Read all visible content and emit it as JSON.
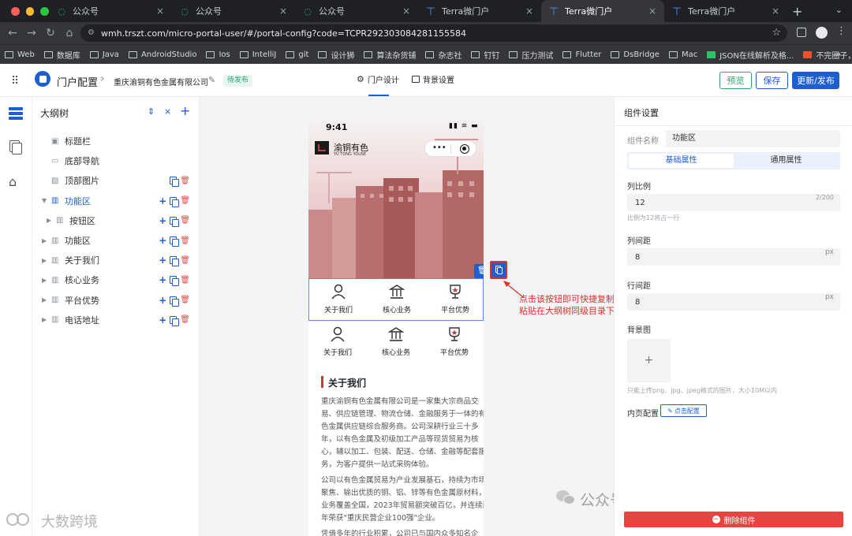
{
  "browser": {
    "tabs": [
      {
        "label": "公众号",
        "icon": "wechat-icon",
        "active": false
      },
      {
        "label": "公众号",
        "icon": "wechat-icon",
        "active": false
      },
      {
        "label": "公众号",
        "icon": "wechat-icon",
        "active": false
      },
      {
        "label": "Terra微门户",
        "icon": "terra-icon",
        "active": false
      },
      {
        "label": "Terra微门户",
        "icon": "terra-icon",
        "active": true
      },
      {
        "label": "Terra微门户",
        "icon": "terra-icon",
        "active": false
      }
    ],
    "url": "wmh.trszt.com/micro-portal-user/#/portal-config?code=TCPR292303084281155584",
    "bookmarks": [
      "Web",
      "数据库",
      "Java",
      "AndroidStudio",
      "Ios",
      "IntelliJ",
      "git",
      "设计狮",
      "算法杂货铺",
      "杂志社",
      "钉钉",
      "压力测试",
      "Flutter",
      "DsBridge",
      "Mac",
      "JSON在线解析及格...",
      "不完圈子，App可..."
    ],
    "colors": {
      "close": "#ff5f57",
      "minimize": "#febc2e",
      "maximize": "#28c840"
    }
  },
  "header": {
    "app_title": "门户配置",
    "separator": "›",
    "company": "重庆渝铜有色金属有限公司",
    "status_badge": "待发布",
    "tabs": [
      {
        "label": "门户设计",
        "icon": "gear-icon",
        "active": true
      },
      {
        "label": "背景设置",
        "icon": "image-icon",
        "active": false
      }
    ],
    "preview_label": "预览",
    "save_label": "保存",
    "publish_label": "更新/发布"
  },
  "outline": {
    "title": "大纲树",
    "rows": [
      {
        "label": "标题栏",
        "icon": "title-bar-icon",
        "caret": false,
        "level": 0,
        "actions": "none",
        "selected": false
      },
      {
        "label": "底部导航",
        "icon": "bottom-nav-icon",
        "caret": false,
        "level": 0,
        "actions": "none",
        "selected": false
      },
      {
        "label": "顶部图片",
        "icon": "image-icon",
        "caret": false,
        "level": 0,
        "actions": "copy-del",
        "selected": false
      },
      {
        "label": "功能区",
        "icon": "grid-icon",
        "caret": "down",
        "level": 0,
        "actions": "all",
        "selected": true
      },
      {
        "label": "按钮区",
        "icon": "grid-icon",
        "caret": "right",
        "level": 1,
        "actions": "all",
        "selected": false
      },
      {
        "label": "功能区",
        "icon": "grid-icon",
        "caret": "right",
        "level": 0,
        "actions": "all",
        "selected": false
      },
      {
        "label": "关于我们",
        "icon": "grid-icon",
        "caret": "right",
        "level": 0,
        "actions": "all",
        "selected": false
      },
      {
        "label": "核心业务",
        "icon": "grid-icon",
        "caret": "right",
        "level": 0,
        "actions": "all",
        "selected": false
      },
      {
        "label": "平台优势",
        "icon": "grid-icon",
        "caret": "right",
        "level": 0,
        "actions": "all",
        "selected": false
      },
      {
        "label": "电话地址",
        "icon": "grid-icon",
        "caret": "right",
        "level": 0,
        "actions": "all",
        "selected": false
      }
    ]
  },
  "phone": {
    "time": "9:41",
    "brand_cn": "渝铜有色",
    "brand_en": "YU TONG YOUSE",
    "menu_dots": "•••",
    "features_row1": [
      {
        "label": "关于我们",
        "icon": "person-icon"
      },
      {
        "label": "核心业务",
        "icon": "bank-icon"
      },
      {
        "label": "平台优势",
        "icon": "trophy-icon"
      }
    ],
    "features_row2": [
      {
        "label": "关于我们",
        "icon": "person-icon"
      },
      {
        "label": "核心业务",
        "icon": "bank-icon"
      },
      {
        "label": "平台优势",
        "icon": "trophy-icon"
      }
    ],
    "about_title": "关于我们",
    "about_p1": "重庆渝铜有色金属有限公司是一家集大宗商品交易、供应链管理、物流仓储、金融服务于一体的有色金属供应链综合服务商。公司深耕行业三十多年，以有色金属及初级加工产品等现货贸易为核心，辅以加工、包装、配送、仓储、金融等配套服务，为客户提供一站式采购体验。",
    "about_p2": "公司以有色金属贸易为产业发展基石，持续为市场聚焦、输出优质的铜、铝、锌等有色金属原材料，业务覆盖全国，2023年贸易额突破百亿，并连续两年荣获\"重庆民营企业100强\"企业。",
    "about_p3": "凭借多年的行业积累，公司已与国内众多知名企"
  },
  "callout": "点击该按钮即可快捷复制组件，并粘贴在大纲树同级目录下",
  "settings": {
    "title": "组件设置",
    "name_label": "组件名称",
    "name_value": "功能区",
    "tab_basic": "基础属性",
    "tab_general": "通用属性",
    "ratio_label": "列比例",
    "ratio_value": "12",
    "ratio_count": "2/200",
    "ratio_hint": "比例为12将占一行",
    "col_gap_label": "列间距",
    "col_gap_value": "8",
    "row_gap_label": "行间距",
    "row_gap_value": "8",
    "unit": "px",
    "bg_label": "背景图",
    "upload_plus": "+",
    "bg_hint": "只能上传png、jpg、jpeg格式的图片，大小10M以内",
    "inner_label": "内页配置",
    "inner_button": "点击配置",
    "delete_button": "删除组件"
  },
  "watermarks": {
    "wechat": "公众号 · Terra微门户",
    "left": "大数跨境"
  }
}
